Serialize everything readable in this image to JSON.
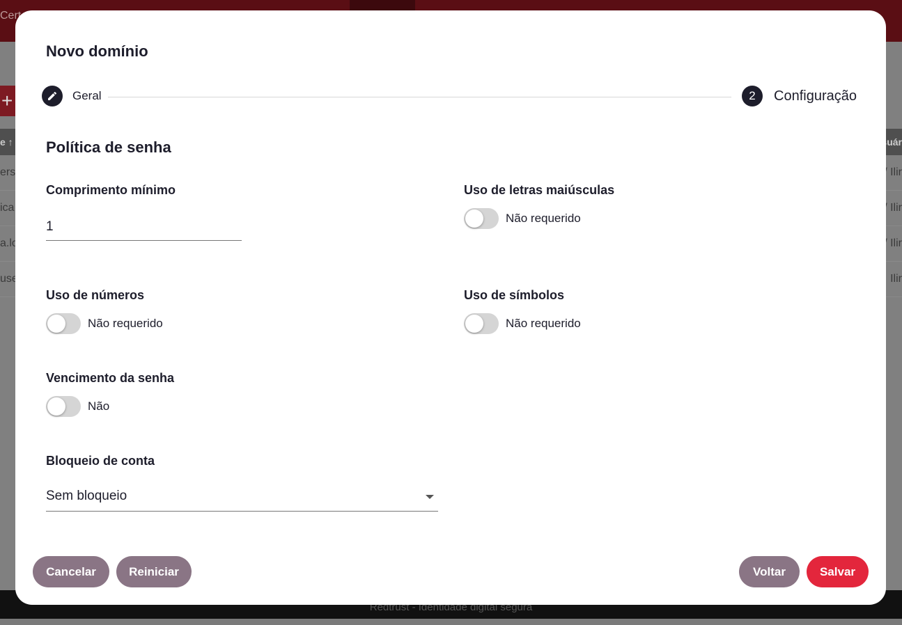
{
  "background": {
    "topbar_text": "Cert",
    "plus_symbol": "+",
    "header_left": "e ↑",
    "header_right": "Usuár",
    "rows": [
      {
        "left": "ers",
        "right": "/ Ilir"
      },
      {
        "left": "ica",
        "right": "/ Ilir"
      },
      {
        "left": "a.lo",
        "right": "/ Ilir"
      },
      {
        "left": "use",
        "right": "Ilir"
      }
    ],
    "footer_text": "Redtrust - Identidade digital segura"
  },
  "modal": {
    "title": "Novo domínio",
    "stepper": {
      "step1_label": "Geral",
      "step1_icon": "pencil-icon",
      "step2_number": "2",
      "step2_label": "Configuração"
    },
    "section_title": "Política de senha",
    "min_length": {
      "label": "Comprimento mínimo",
      "value": "1"
    },
    "uppercase": {
      "label": "Uso de letras maiúsculas",
      "status": "Não requerido",
      "enabled": false
    },
    "numbers": {
      "label": "Uso de números",
      "status": "Não requerido",
      "enabled": false
    },
    "symbols": {
      "label": "Uso de símbolos",
      "status": "Não requerido",
      "enabled": false
    },
    "expiration": {
      "label": "Vencimento da senha",
      "status": "Não",
      "enabled": false
    },
    "lockout": {
      "label": "Bloqueio de conta",
      "value": "Sem bloqueio"
    },
    "buttons": {
      "cancel": "Cancelar",
      "reset": "Reiniciar",
      "back": "Voltar",
      "save": "Salvar"
    },
    "colors": {
      "primary": "#e3263c",
      "muted": "#8a7585",
      "dark": "#1d1d2b"
    }
  }
}
